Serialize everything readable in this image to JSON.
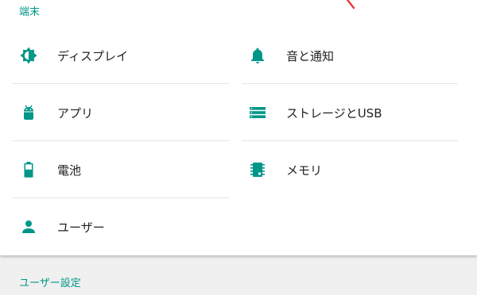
{
  "colors": {
    "accent": "#009688",
    "text": "#212121",
    "divider": "#e3e3e3",
    "background": "#f0f0f0"
  },
  "section_device": {
    "title": "端末"
  },
  "section_user": {
    "title": "ユーザー設定"
  },
  "items": [
    {
      "label": "ディスプレイ",
      "icon": "brightness-icon"
    },
    {
      "label": "音と通知",
      "icon": "bell-icon"
    },
    {
      "label": "アプリ",
      "icon": "android-icon"
    },
    {
      "label": "ストレージとUSB",
      "icon": "storage-icon"
    },
    {
      "label": "電池",
      "icon": "battery-icon"
    },
    {
      "label": "メモリ",
      "icon": "memory-chip-icon"
    },
    {
      "label": "ユーザー",
      "icon": "person-icon"
    }
  ]
}
